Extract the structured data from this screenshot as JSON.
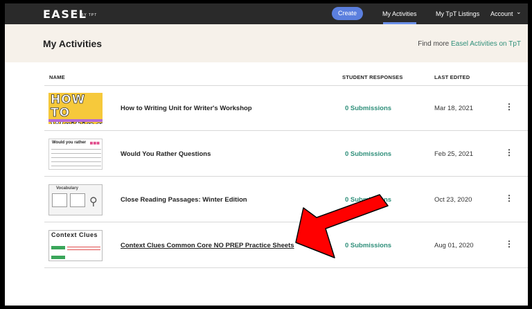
{
  "nav": {
    "logo": "EASEL",
    "logo_sub": "BY TPT",
    "create": "Create",
    "links": [
      "My Activities",
      "My TpT Listings",
      "Account"
    ]
  },
  "header": {
    "title": "My Activities",
    "find_prefix": "Find more ",
    "find_link": "Easel Activities on TpT"
  },
  "table": {
    "columns": [
      "NAME",
      "STUDENT RESPONSES",
      "LAST EDITED"
    ],
    "rows": [
      {
        "title": "How to Writing Unit for Writer's Workshop",
        "responses": "0 Submissions",
        "edited": "Mar 18, 2021",
        "thumb": {
          "text": "HOW TO\nWriting"
        }
      },
      {
        "title": "Would You Rather Questions",
        "responses": "0 Submissions",
        "edited": "Feb 25, 2021",
        "thumb": {
          "text": "Would you rather"
        }
      },
      {
        "title": "Close Reading Passages: Winter Edition",
        "responses": "0 Submissions",
        "edited": "Oct 23, 2020",
        "thumb": {
          "text": "Vocabulary"
        }
      },
      {
        "title": "Context Clues Common Core NO PREP Practice Sheets",
        "responses": "0 Submissions",
        "edited": "Aug 01, 2020",
        "thumb": {
          "text": "Context Clues"
        }
      }
    ]
  },
  "icons": {
    "menu": "kebab-menu-icon",
    "account": "chevron-down-icon",
    "annotation": "red-arrow"
  },
  "colors": {
    "nav_bg": "#2a2a2a",
    "create_btn": "#5b7fde",
    "accent_green": "#2f8f7a",
    "header_bg": "#f6f1ea",
    "arrow": "#ff0000"
  }
}
